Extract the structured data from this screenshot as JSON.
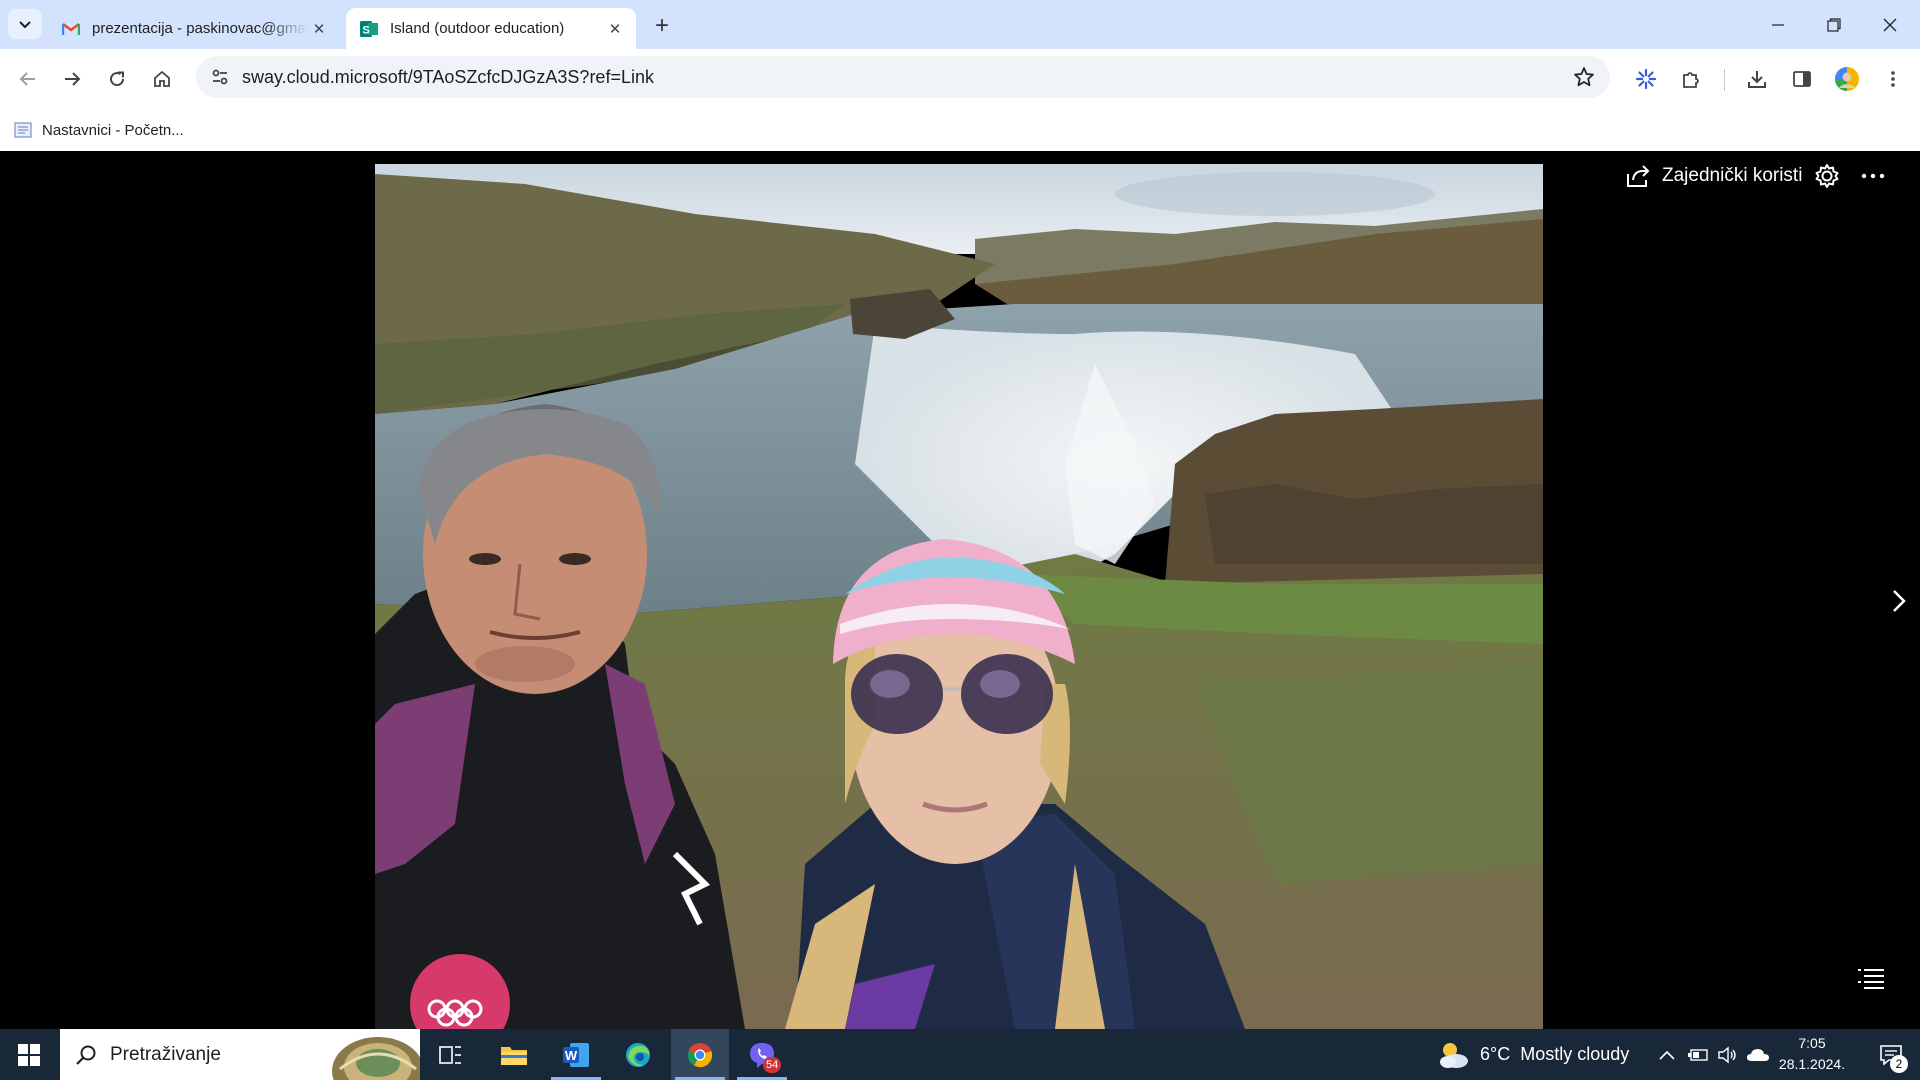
{
  "browser": {
    "tabs": [
      {
        "title": "prezentacija - paskinovac@gmail.com",
        "favicon": "gmail-icon",
        "active": false
      },
      {
        "title": "Island (outdoor education)",
        "favicon": "sway-icon",
        "active": true
      }
    ],
    "url": "sway.cloud.microsoft/9TAoSZcfcDJGzA3S?ref=Link",
    "bookmarks": [
      {
        "label": "Nastavnici - Početn..."
      }
    ]
  },
  "sway": {
    "share_label": "Zajednički koristi",
    "photo_alt": "Selfie of two people in front of a waterfall in Iceland"
  },
  "taskbar": {
    "search_placeholder": "Pretraživanje",
    "apps": [
      "task-view",
      "file-explorer",
      "word",
      "edge",
      "chrome",
      "viber"
    ],
    "viber_badge": "54",
    "weather": {
      "temp": "6°C",
      "condition": "Mostly cloudy"
    },
    "time": "7:05",
    "date": "28.1.2024.",
    "notifications": "2"
  },
  "colors": {
    "tabstrip": "#d3e3fd",
    "taskbar": "#182838",
    "accent": "#8ab4f8"
  }
}
